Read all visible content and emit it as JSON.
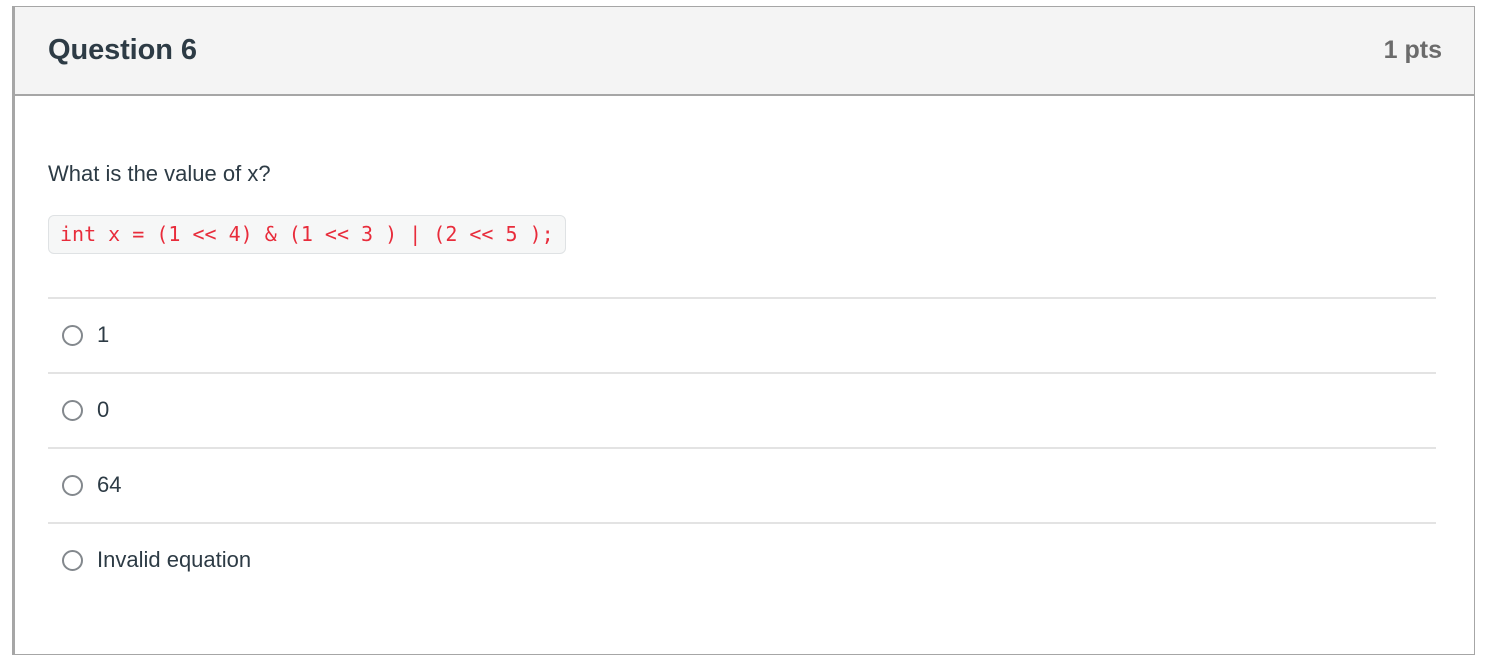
{
  "question": {
    "title": "Question 6",
    "points": "1 pts",
    "prompt": "What is the value of x?",
    "code": "int x = (1 << 4) & (1 << 3 ) | (2 << 5 );",
    "answers": [
      {
        "label": "1",
        "selected": false
      },
      {
        "label": "0",
        "selected": false
      },
      {
        "label": "64",
        "selected": false
      },
      {
        "label": "Invalid equation",
        "selected": false
      }
    ]
  },
  "colors": {
    "text": "#2d3b45",
    "points": "#6b6b6b",
    "code": "#e82c3b",
    "header_bg": "#f4f4f4",
    "border": "#a6a6a6",
    "separator": "#e3e3e3"
  }
}
